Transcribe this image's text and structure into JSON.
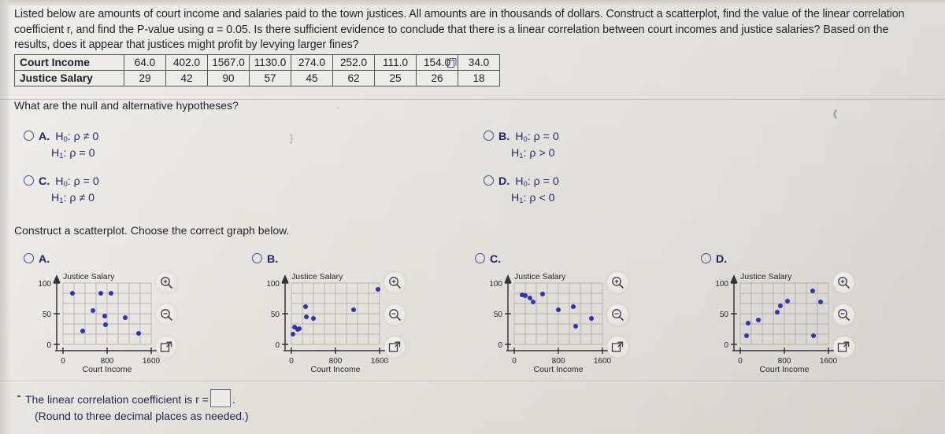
{
  "statement": {
    "line1": "Listed below are amounts of court income and salaries paid to the town justices. All amounts are in thousands of dollars. Construct a scatterplot, find the value of the linear correlation",
    "line2": "coefficient r, and find the P-value using α = 0.05. Is there sufficient evidence to conclude that there is a linear correlation between court incomes and justice salaries? Based on the",
    "line3": "results, does it appear that justices might profit by levying larger fines?"
  },
  "data_table": {
    "rows": [
      {
        "header": "Court Income",
        "values": [
          "64.0",
          "402.0",
          "1567.0",
          "1130.0",
          "274.0",
          "252.0",
          "111.0",
          "154.0",
          "34.0"
        ]
      },
      {
        "header": "Justice Salary",
        "values": [
          "29",
          "42",
          "90",
          "57",
          "45",
          "62",
          "25",
          "26",
          "18"
        ]
      }
    ],
    "copy_icon": "copy-icon"
  },
  "questions": {
    "hypotheses_prompt": "What are the null and alternative hypotheses?",
    "scatterplot_prompt": "Construct a scatterplot. Choose the correct graph below."
  },
  "hypothesis_choices": [
    {
      "letter": "A.",
      "h0_sym": "H",
      "h0_sub": "0",
      "h0_text": ": ρ ≠ 0",
      "h1_sym": "H",
      "h1_sub": "1",
      "h1_text": ": ρ = 0"
    },
    {
      "letter": "B.",
      "h0_sym": "H",
      "h0_sub": "0",
      "h0_text": ": ρ = 0",
      "h1_sym": "H",
      "h1_sub": "1",
      "h1_text": ": ρ > 0"
    },
    {
      "letter": "C.",
      "h0_sym": "H",
      "h0_sub": "0",
      "h0_text": ": ρ = 0",
      "h1_sym": "H",
      "h1_sub": "1",
      "h1_text": ": ρ ≠ 0"
    },
    {
      "letter": "D.",
      "h0_sym": "H",
      "h0_sub": "0",
      "h0_text": ": ρ = 0",
      "h1_sym": "H",
      "h1_sub": "1",
      "h1_text": ": ρ < 0"
    }
  ],
  "graph_options": [
    {
      "letter": "A.",
      "name": "graph-option-a"
    },
    {
      "letter": "B.",
      "name": "graph-option-b"
    },
    {
      "letter": "C.",
      "name": "graph-option-c"
    },
    {
      "letter": "D.",
      "name": "graph-option-d"
    }
  ],
  "tools": {
    "zoom_in": "zoom-in-icon",
    "zoom_out": "zoom-out-icon",
    "expand": "expand-icon"
  },
  "answer": {
    "prompt": "The linear correlation coefficient is r =",
    "value": "",
    "period": ".",
    "hint": "(Round to three decimal places as needed.)"
  },
  "colors": {
    "point": "#3333b0",
    "axis": "#3a3a44",
    "grid": "#9a9590",
    "choice_text": "#2a2a60"
  },
  "chart_data": [
    {
      "type": "scatter",
      "option": "A",
      "title": "",
      "xlabel": "Court Income",
      "ylabel": "Justice Salary",
      "xlim": [
        0,
        1800
      ],
      "ylim": [
        0,
        110
      ],
      "xticks": [
        0,
        800,
        1600
      ],
      "yticks": [
        0,
        50,
        100
      ],
      "grid": true,
      "points": [
        [
          190,
          83
        ],
        [
          390,
          22
        ],
        [
          600,
          56
        ],
        [
          750,
          83
        ],
        [
          830,
          47
        ],
        [
          840,
          33
        ],
        [
          960,
          83
        ],
        [
          1230,
          44
        ],
        [
          1480,
          18
        ]
      ]
    },
    {
      "type": "scatter",
      "option": "B",
      "title": "",
      "xlabel": "Court Income",
      "ylabel": "Justice Salary",
      "xlim": [
        0,
        1800
      ],
      "ylim": [
        0,
        110
      ],
      "xticks": [
        0,
        800,
        1600
      ],
      "yticks": [
        0,
        50,
        100
      ],
      "grid": true,
      "points": [
        [
          34,
          18
        ],
        [
          64,
          29
        ],
        [
          111,
          25
        ],
        [
          154,
          26
        ],
        [
          252,
          62
        ],
        [
          274,
          45
        ],
        [
          402,
          42
        ],
        [
          1130,
          57
        ],
        [
          1567,
          90
        ]
      ]
    },
    {
      "type": "scatter",
      "option": "C",
      "title": "",
      "xlabel": "Court Income",
      "ylabel": "Justice Salary",
      "xlim": [
        0,
        1800
      ],
      "ylim": [
        0,
        110
      ],
      "xticks": [
        0,
        800,
        1600
      ],
      "yticks": [
        0,
        50,
        100
      ],
      "grid": true,
      "points": [
        [
          160,
          82
        ],
        [
          200,
          81
        ],
        [
          290,
          78
        ],
        [
          340,
          72
        ],
        [
          520,
          83
        ],
        [
          800,
          57
        ],
        [
          1080,
          62
        ],
        [
          1120,
          30
        ],
        [
          1400,
          43
        ]
      ]
    },
    {
      "type": "scatter",
      "option": "D",
      "title": "",
      "xlabel": "Court Income",
      "ylabel": "Justice Salary",
      "xlim": [
        0,
        1800
      ],
      "ylim": [
        0,
        110
      ],
      "xticks": [
        0,
        800,
        1600
      ],
      "yticks": [
        0,
        50,
        100
      ],
      "grid": true,
      "points": [
        [
          130,
          15
        ],
        [
          160,
          36
        ],
        [
          360,
          41
        ],
        [
          700,
          53
        ],
        [
          760,
          64
        ],
        [
          900,
          72
        ],
        [
          1360,
          88
        ],
        [
          1380,
          15
        ],
        [
          1500,
          71
        ]
      ]
    }
  ]
}
